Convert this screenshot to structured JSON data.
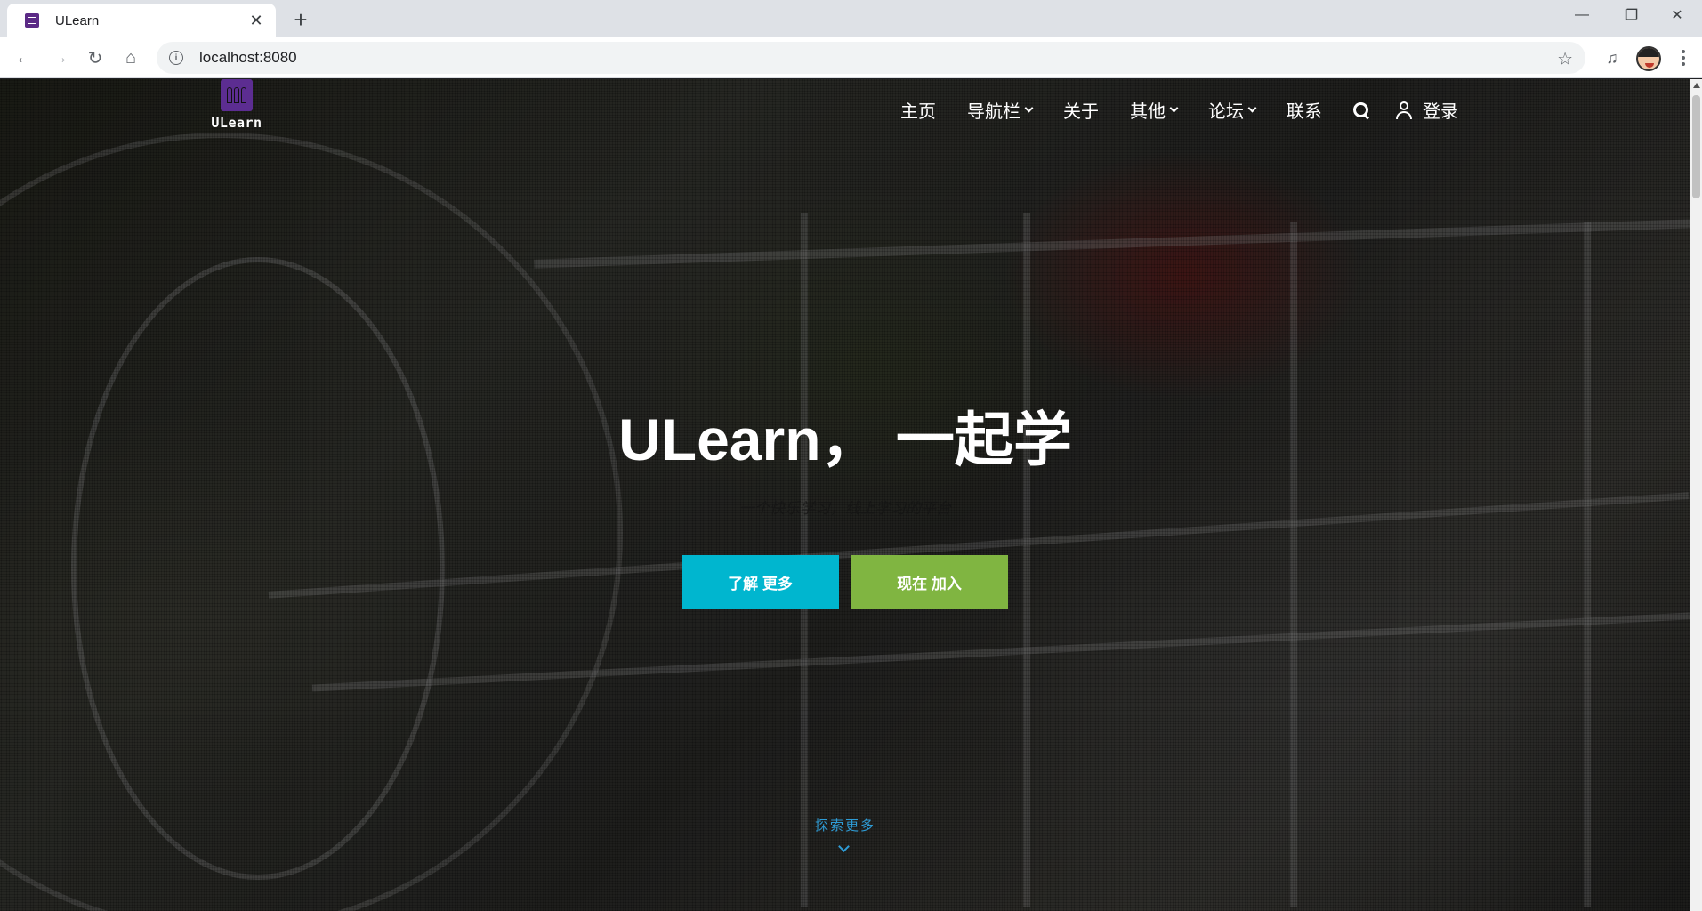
{
  "browser": {
    "tab_title": "ULearn",
    "tab_close": "✕",
    "new_tab": "+",
    "url": "localhost:8080",
    "window_controls": {
      "minimize": "—",
      "restore": "❐",
      "close": "✕"
    }
  },
  "site": {
    "logo_text": "ULearn",
    "nav": {
      "items": [
        "主页",
        "导航栏",
        "关于",
        "其他",
        "论坛",
        "联系"
      ],
      "login": "登录"
    },
    "hero": {
      "title": "ULearn， 一起学",
      "subtitle": "一个快乐学习，线上学习的平台",
      "learn_more": "了解 更多",
      "join_now": "现在 加入",
      "explore_more": "探索更多"
    }
  },
  "colors": {
    "learn_button": "#00b6cf",
    "join_button": "#80b541",
    "explore": "#2e9cd6",
    "logo": "#5c2d91"
  },
  "icons": {
    "back": "arrow-left-icon",
    "forward": "arrow-right-icon",
    "reload": "reload-icon",
    "home": "home-icon",
    "search": "search-icon",
    "user": "user-icon"
  }
}
